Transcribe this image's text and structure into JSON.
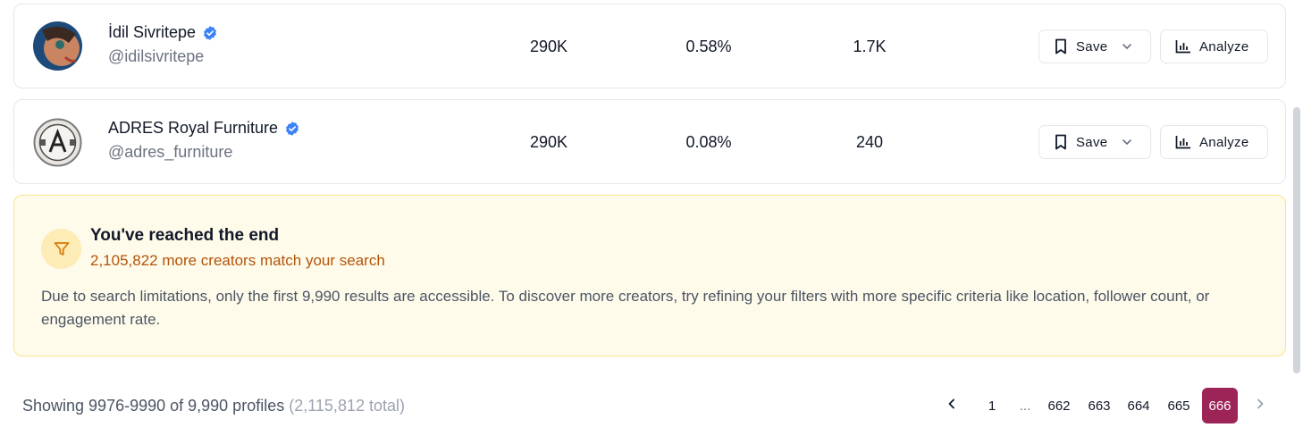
{
  "rows": [
    {
      "name": "İdil Sivritepe",
      "handle": "@idilsivritepe",
      "followers": "290K",
      "engagement_rate": "0.58%",
      "avg_likes": "1.7K",
      "save_label": "Save",
      "analyze_label": "Analyze"
    },
    {
      "name": "ADRES Royal Furniture",
      "handle": "@adres_furniture",
      "followers": "290K",
      "engagement_rate": "0.08%",
      "avg_likes": "240",
      "save_label": "Save",
      "analyze_label": "Analyze"
    }
  ],
  "end_notice": {
    "title": "You've reached the end",
    "subtitle": "2,105,822 more creators match your search",
    "body": "Due to search limitations, only the first 9,990 results are accessible. To discover more creators, try refining your filters with more specific criteria like location, follower count, or engagement rate.",
    "icon": "filter-icon"
  },
  "footer": {
    "showing": "Showing 9976-9990 of 9,990 profiles",
    "total": "(2,115,812 total)"
  },
  "pagination": {
    "pages": [
      "1",
      "...",
      "662",
      "663",
      "664",
      "665",
      "666"
    ],
    "active": "666"
  },
  "colors": {
    "accent": "#9d2457",
    "verified": "#3b82f6",
    "notice_bg": "#fffbeb",
    "notice_border": "#fbe38b",
    "notice_subtitle": "#b45309"
  }
}
